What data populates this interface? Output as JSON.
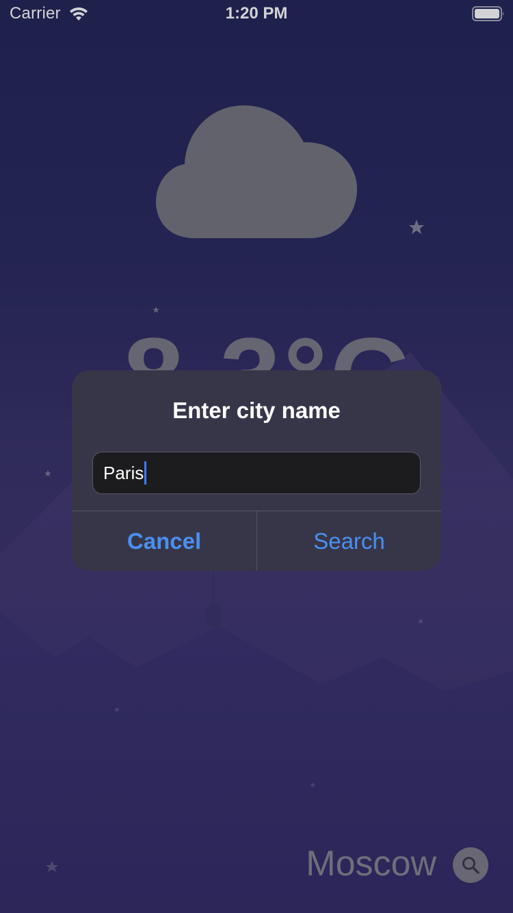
{
  "status_bar": {
    "carrier": "Carrier",
    "time": "1:20 PM"
  },
  "weather": {
    "condition_icon": "cloud-icon",
    "temperature": "8.3°C",
    "city": "Moscow",
    "search_icon": "magnifying-glass-icon"
  },
  "alert": {
    "title": "Enter city name",
    "input_value": "Paris",
    "cancel_label": "Cancel",
    "search_label": "Search"
  },
  "colors": {
    "accent": "#4a90ef",
    "alert_background": "#373649",
    "input_background": "#1c1c1e"
  }
}
